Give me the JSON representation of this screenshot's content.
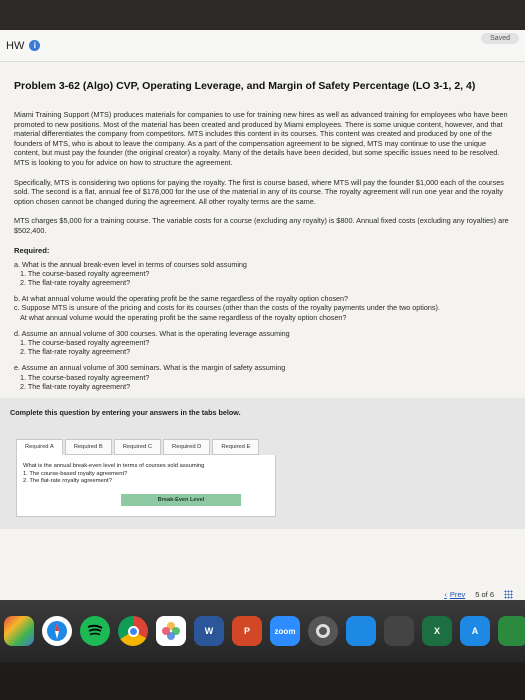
{
  "header": {
    "title": "HW",
    "saved_label": "Saved"
  },
  "problem": {
    "title": "Problem 3-62 (Algo) CVP, Operating Leverage, and Margin of Safety Percentage (LO 3-1, 2, 4)",
    "para1": "Miami Training Support (MTS) produces materials for companies to use for training new hires as well as advanced training for employees who have been promoted to new positions. Most of the material has been created and produced by Miami employees. There is some unique content, however, and that material differentiates the company from competitors. MTS includes this content in its courses. This content was created and produced by one of the founders of MTS, who is about to leave the company. As a part of the compensation agreement to be signed, MTS may continue to use the unique content, but must pay the founder (the original creator) a royalty. Many of the details have been decided, but some specific issues need to be resolved. MTS is looking to you for advice on how to structure the agreement.",
    "para2": "Specifically, MTS is considering two options for paying the royalty. The first is course based, where MTS will pay the founder $1,000 each of the courses sold. The second is a flat, annual fee of $178,000 for the use of the material in any of its course. The royalty agreement will run one year and the royalty option chosen cannot be changed during the agreement. All other royalty terms are the same.",
    "para3": "MTS charges $5,000 for a training course. The variable costs for a course (excluding any royalty) is $800. Annual fixed costs (excluding any royalties) are $502,400."
  },
  "required": {
    "title": "Required:",
    "a": "a. What is the annual break-even level in terms of courses sold assuming",
    "a1": "1. The course-based royalty agreement?",
    "a2": "2. The flat-rate royalty agreement?",
    "b": "b. At what annual volume would the operating profit be the same regardless of the royalty option chosen?",
    "c": "c. Suppose MTS is unsure of the pricing and costs for its courses (other than the costs of the royalty payments under the two options).",
    "c_sub": "At what annual volume would the operating profit be the same regardless of the royalty option chosen?",
    "d": "d. Assume an annual volume of 300 courses. What is the operating leverage assuming",
    "d1": "1. The course-based royalty agreement?",
    "d2": "2. The flat-rate royalty agreement?",
    "e": "e. Assume an annual volume of 300 seminars. What is the margin of safety assuming",
    "e1": "1. The course-based royalty agreement?",
    "e2": "2. The flat-rate royalty agreement?"
  },
  "instruction": "Complete this question by entering your answers in the tabs below.",
  "tabs": [
    "Required A",
    "Required B",
    "Required C",
    "Required D",
    "Required E"
  ],
  "panel": {
    "question": "What is the annual break-even level in terms of courses sold assuming",
    "q1": "1. The course-based royalty agreement?",
    "q2": "2. The flat-rate royalty agreement?",
    "column_header": "Break-Even Level"
  },
  "pager": {
    "prev_label": "Prev",
    "page_text": "5 of 6"
  },
  "dock": {
    "zoom_label": "zoom",
    "word_letter": "W",
    "ppt_letter": "P"
  }
}
